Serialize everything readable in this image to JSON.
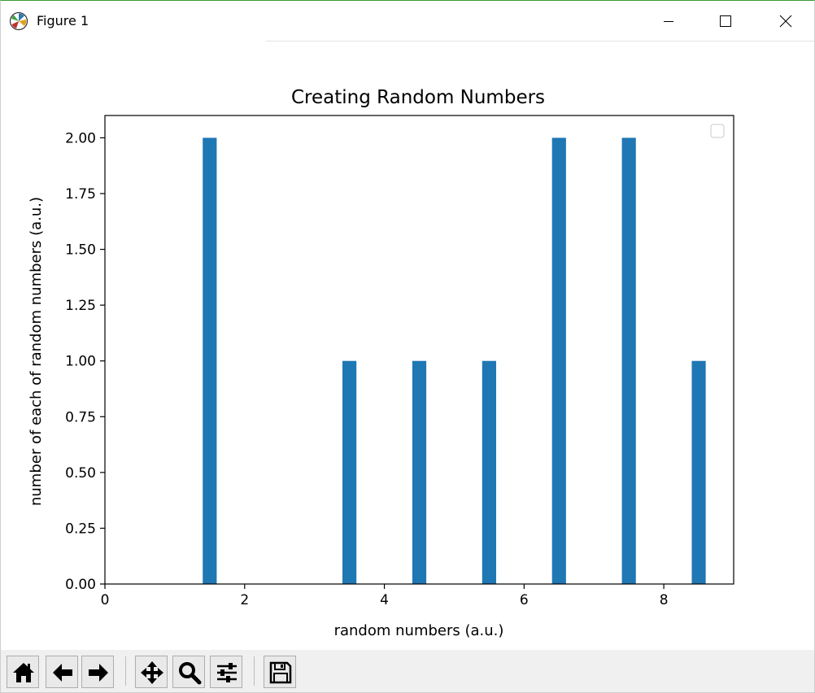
{
  "window": {
    "title": "Figure 1",
    "icon": "matplotlib-logo-icon",
    "controls": [
      "minimize-icon",
      "maximize-icon",
      "close-icon"
    ]
  },
  "toolbar": {
    "buttons": [
      {
        "name": "home-button",
        "icon": "home-icon"
      },
      {
        "name": "back-button",
        "icon": "arrow-left-icon"
      },
      {
        "name": "forward-button",
        "icon": "arrow-right-icon"
      },
      {
        "name": "pan-button",
        "icon": "move-arrows-icon"
      },
      {
        "name": "zoom-button",
        "icon": "magnifier-icon"
      },
      {
        "name": "subplots-button",
        "icon": "sliders-icon"
      },
      {
        "name": "save-button",
        "icon": "floppy-disk-icon"
      }
    ]
  },
  "chart_data": {
    "type": "bar",
    "title": "Creating Random Numbers",
    "xlabel": "random numbers (a.u.)",
    "ylabel": "number of each of random numbers (a.u.)",
    "xlim": [
      0,
      9
    ],
    "ylim": [
      0,
      2.1
    ],
    "xticks": [
      0,
      2,
      4,
      6,
      8
    ],
    "xtick_labels": [
      "0",
      "2",
      "4",
      "6",
      "8"
    ],
    "yticks": [
      0,
      0.25,
      0.5,
      0.75,
      1.0,
      1.25,
      1.5,
      1.75,
      2.0
    ],
    "ytick_labels": [
      "0.00",
      "0.25",
      "0.50",
      "0.75",
      "1.00",
      "1.25",
      "1.50",
      "1.75",
      "2.00"
    ],
    "bar_width": 0.2,
    "x": [
      1.5,
      3.5,
      4.5,
      5.5,
      6.5,
      7.5,
      8.5
    ],
    "values": [
      2,
      1,
      1,
      1,
      2,
      2,
      1
    ],
    "bar_color": "#1f77b4",
    "grid": false,
    "legend": "top-right, empty"
  }
}
